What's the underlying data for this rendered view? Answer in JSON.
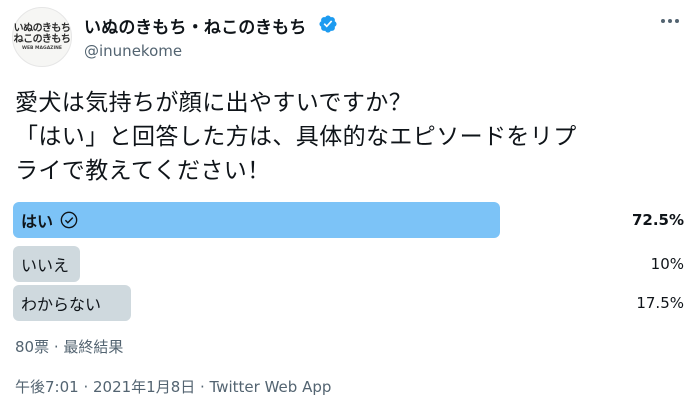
{
  "author": {
    "display_name": "いぬのきもち・ねこのきもち",
    "handle": "@inunekome",
    "avatar_text": {
      "line1": "いぬのきもち",
      "line2": "ねこのきもち",
      "line3": "WEB MAGAZINE"
    },
    "verified_icon": "verified-badge-icon"
  },
  "tweet": {
    "text": "愛犬は気持ちが顔に出やすいですか？\n「はい」と回答した方は、具体的なエピソードをリプ\nライで教えてください！"
  },
  "poll": {
    "options": [
      {
        "label": "はい",
        "percent_text": "72.5%",
        "percent": 72.5,
        "winner": true
      },
      {
        "label": "いいえ",
        "percent_text": "10%",
        "percent": 10,
        "winner": false
      },
      {
        "label": "わからない",
        "percent_text": "17.5%",
        "percent": 17.5,
        "winner": false
      }
    ],
    "meta": "80票 · 最終結果"
  },
  "footer": {
    "timestamp": "午後7:01 · 2021年1月8日 · Twitter Web App"
  },
  "colors": {
    "winner_fill": "#7cc3f7",
    "other_fill": "#cfd9de",
    "verified": "#1d9bf0",
    "secondary_text": "#536471"
  }
}
